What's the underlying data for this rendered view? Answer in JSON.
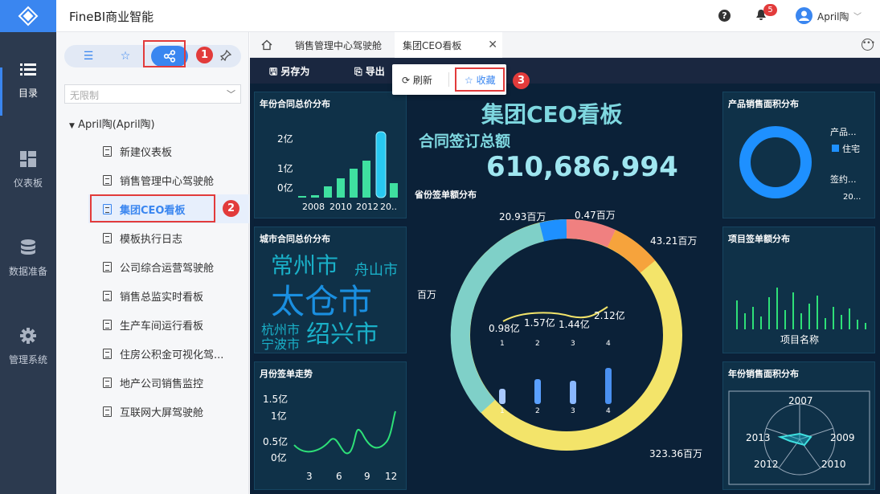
{
  "app": {
    "title": "FineBI商业智能",
    "notification_count": "5",
    "user": "April陶",
    "help_icon": "?"
  },
  "leftnav": [
    {
      "label": "目录"
    },
    {
      "label": "仪表板"
    },
    {
      "label": "数据准备"
    },
    {
      "label": "管理系统"
    }
  ],
  "tree": {
    "filter": "无限制",
    "root": "April陶(April陶)",
    "items": [
      "新建仪表板",
      "销售管理中心驾驶舱",
      "集团CEO看板",
      "模板执行日志",
      "公司综合运营驾驶舱",
      "销售总监实时看板",
      "生产车间运行看板",
      "住房公积金可视化驾...",
      "地产公司销售监控",
      "互联网大屏驾驶舱"
    ],
    "selected": "集团CEO看板"
  },
  "annotations": [
    "1",
    "2",
    "3"
  ],
  "tabs": {
    "items": [
      "销售管理中心驾驶舱",
      "集团CEO看板"
    ],
    "active": "集团CEO看板"
  },
  "toolbar": {
    "save_as": "另存为",
    "export": "导出",
    "refresh": "刷新",
    "favorite": "收藏"
  },
  "dashboard": {
    "title": "集团CEO看板",
    "kpi_label": "合同签订总额",
    "kpi_value": "610,686,994",
    "p1": {
      "title": "年份合同总价分布",
      "yticks": [
        "2亿",
        "1亿",
        "0亿"
      ],
      "xticks": [
        "2008",
        "2010",
        "2012",
        "20.."
      ]
    },
    "p2": {
      "title": "城市合同总价分布",
      "words": [
        "常州市",
        "舟山市",
        "太仓市",
        "杭州市",
        "绍兴市",
        "宁波市"
      ]
    },
    "p3": {
      "title": "月份签单走势",
      "yticks": [
        "1.5亿",
        "1亿",
        "0.5亿",
        "0亿"
      ],
      "xticks": [
        "3",
        "6",
        "9",
        "12"
      ]
    },
    "center": {
      "title": "省份签单额分布",
      "labels": [
        "20.93百万",
        "0.47百万",
        "43.21百万",
        "百万",
        "323.36百万"
      ],
      "line_labels": [
        "0.98亿",
        "1.57亿",
        "1.44亿",
        "2.12亿"
      ],
      "xticks": [
        "1",
        "2",
        "3",
        "4"
      ]
    },
    "p4": {
      "title": "产品销售面积分布",
      "legend": [
        "产品...",
        "住宅",
        "签约...",
        "20..."
      ]
    },
    "p5": {
      "title": "项目签单额分布",
      "xlabel": "项目名称"
    },
    "p6": {
      "title": "年份销售面积分布",
      "years": [
        "2007",
        "2009",
        "2010",
        "2012",
        "2013"
      ]
    }
  },
  "colors": {
    "accent": "#3a86f0",
    "annotation": "#e23b3b",
    "dash_bg": "#0b2138"
  }
}
